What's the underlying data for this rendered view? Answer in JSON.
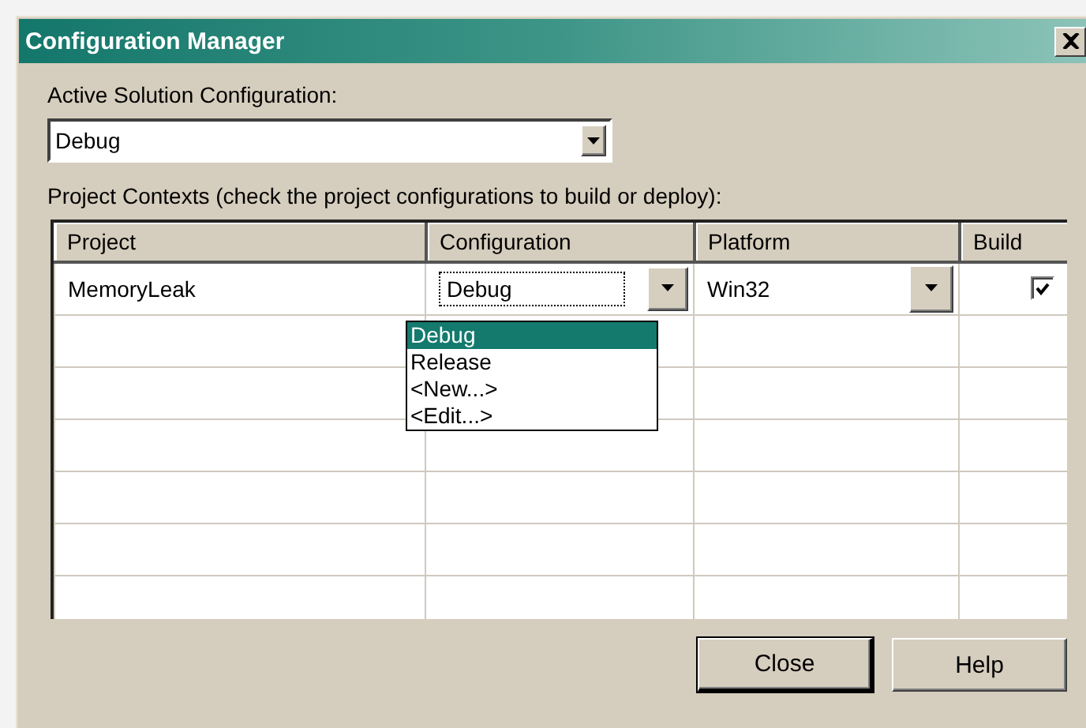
{
  "window": {
    "title": "Configuration Manager"
  },
  "active_configuration": {
    "label": "Active Solution Configuration:",
    "value": "Debug"
  },
  "project_contexts": {
    "label": "Project Contexts (check the project configurations to build or deploy):",
    "columns": [
      "Project",
      "Configuration",
      "Platform",
      "Build"
    ],
    "rows": [
      {
        "project": "MemoryLeak",
        "configuration": "Debug",
        "platform": "Win32",
        "build": true
      }
    ],
    "configuration_list": [
      {
        "label": "Debug",
        "selected": true
      },
      {
        "label": "Release",
        "selected": false
      },
      {
        "label": "<New...>",
        "selected": false
      },
      {
        "label": "<Edit...>",
        "selected": false
      }
    ]
  },
  "buttons": [
    {
      "label": "Close",
      "default": true
    },
    {
      "label": "Help",
      "default": false
    }
  ]
}
